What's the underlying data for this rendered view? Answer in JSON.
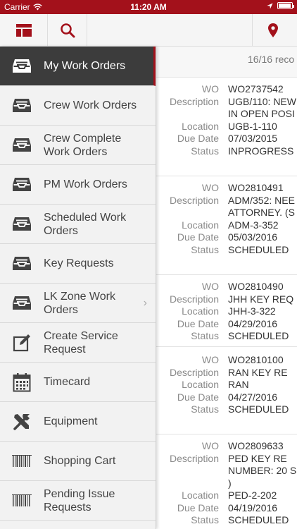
{
  "status_bar": {
    "carrier": "Carrier",
    "time": "11:20 AM"
  },
  "toolbar": {
    "menu_icon": "menu-grid-icon",
    "search_icon": "search-icon",
    "location_icon": "location-pin-icon"
  },
  "accent_color": "#a3111b",
  "sidebar": {
    "items": [
      {
        "label": "My Work Orders",
        "icon": "inbox-tray-icon"
      },
      {
        "label": "Crew Work Orders",
        "icon": "inbox-tray-icon"
      },
      {
        "label": "Crew Complete Work Orders",
        "icon": "inbox-tray-icon"
      },
      {
        "label": "PM Work Orders",
        "icon": "inbox-tray-icon"
      },
      {
        "label": "Scheduled Work Orders",
        "icon": "inbox-tray-icon"
      },
      {
        "label": "Key Requests",
        "icon": "inbox-tray-icon"
      },
      {
        "label": "LK Zone Work Orders",
        "icon": "inbox-tray-icon"
      },
      {
        "label": "Create Service Request",
        "icon": "edit-icon"
      },
      {
        "label": "Timecard",
        "icon": "calendar-icon"
      },
      {
        "label": "Equipment",
        "icon": "tools-icon"
      },
      {
        "label": "Shopping Cart",
        "icon": "barcode-icon"
      },
      {
        "label": "Pending Issue Requests",
        "icon": "barcode-icon"
      }
    ]
  },
  "main": {
    "records": "16/16 reco",
    "labels": {
      "wo": "WO",
      "description": "Description",
      "location": "Location",
      "due_date": "Due Date",
      "status": "Status"
    },
    "work_orders": [
      {
        "wo": "WO2737542",
        "description": [
          "UGB/110: NEW",
          "IN OPEN POSI"
        ],
        "location": "UGB-1-110",
        "due_date": "07/03/2015",
        "status": "INPROGRESS"
      },
      {
        "wo": "WO2810491",
        "description": [
          "ADM/352: NEE",
          "ATTORNEY. (S"
        ],
        "location": "ADM-3-352",
        "due_date": "05/03/2016",
        "status": "SCHEDULED"
      },
      {
        "wo": "WO2810490",
        "description": [
          "JHH KEY REQ"
        ],
        "location": "JHH-3-322",
        "due_date": "04/29/2016",
        "status": "SCHEDULED"
      },
      {
        "wo": "WO2810100",
        "description": [
          "RAN KEY RE"
        ],
        "location": "RAN",
        "due_date": "04/27/2016",
        "status": "SCHEDULED"
      },
      {
        "wo": "WO2809633",
        "description": [
          "PED KEY RE",
          "NUMBER: 20 S",
          ")"
        ],
        "location": "PED-2-202",
        "due_date": "04/19/2016",
        "status": "SCHEDULED"
      }
    ]
  }
}
